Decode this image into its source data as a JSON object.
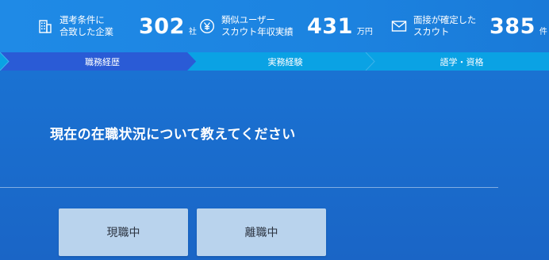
{
  "header": {
    "stats": [
      {
        "icon": "building-icon",
        "label_line1": "選考条件に",
        "label_line2": "合致した企業",
        "value": "302",
        "unit": "社"
      },
      {
        "icon": "yen-icon",
        "label_line1": "類似ユーザー",
        "label_line2": "スカウト年収実績",
        "value": "431",
        "unit": "万円"
      },
      {
        "icon": "mail-icon",
        "label_line1": "面接が確定した",
        "label_line2": "スカウト",
        "value": "385",
        "unit": "件"
      }
    ]
  },
  "steps": {
    "items": [
      {
        "label": "職務経歴",
        "active": true
      },
      {
        "label": "実務経験",
        "active": false
      },
      {
        "label": "語学・資格",
        "active": false
      }
    ],
    "colors": {
      "active": "#2a5bd6",
      "inactive": "#0aa2e4"
    }
  },
  "main": {
    "question": "現在の在職状況について教えてください",
    "choices": [
      {
        "label": "現職中"
      },
      {
        "label": "離職中"
      }
    ]
  }
}
